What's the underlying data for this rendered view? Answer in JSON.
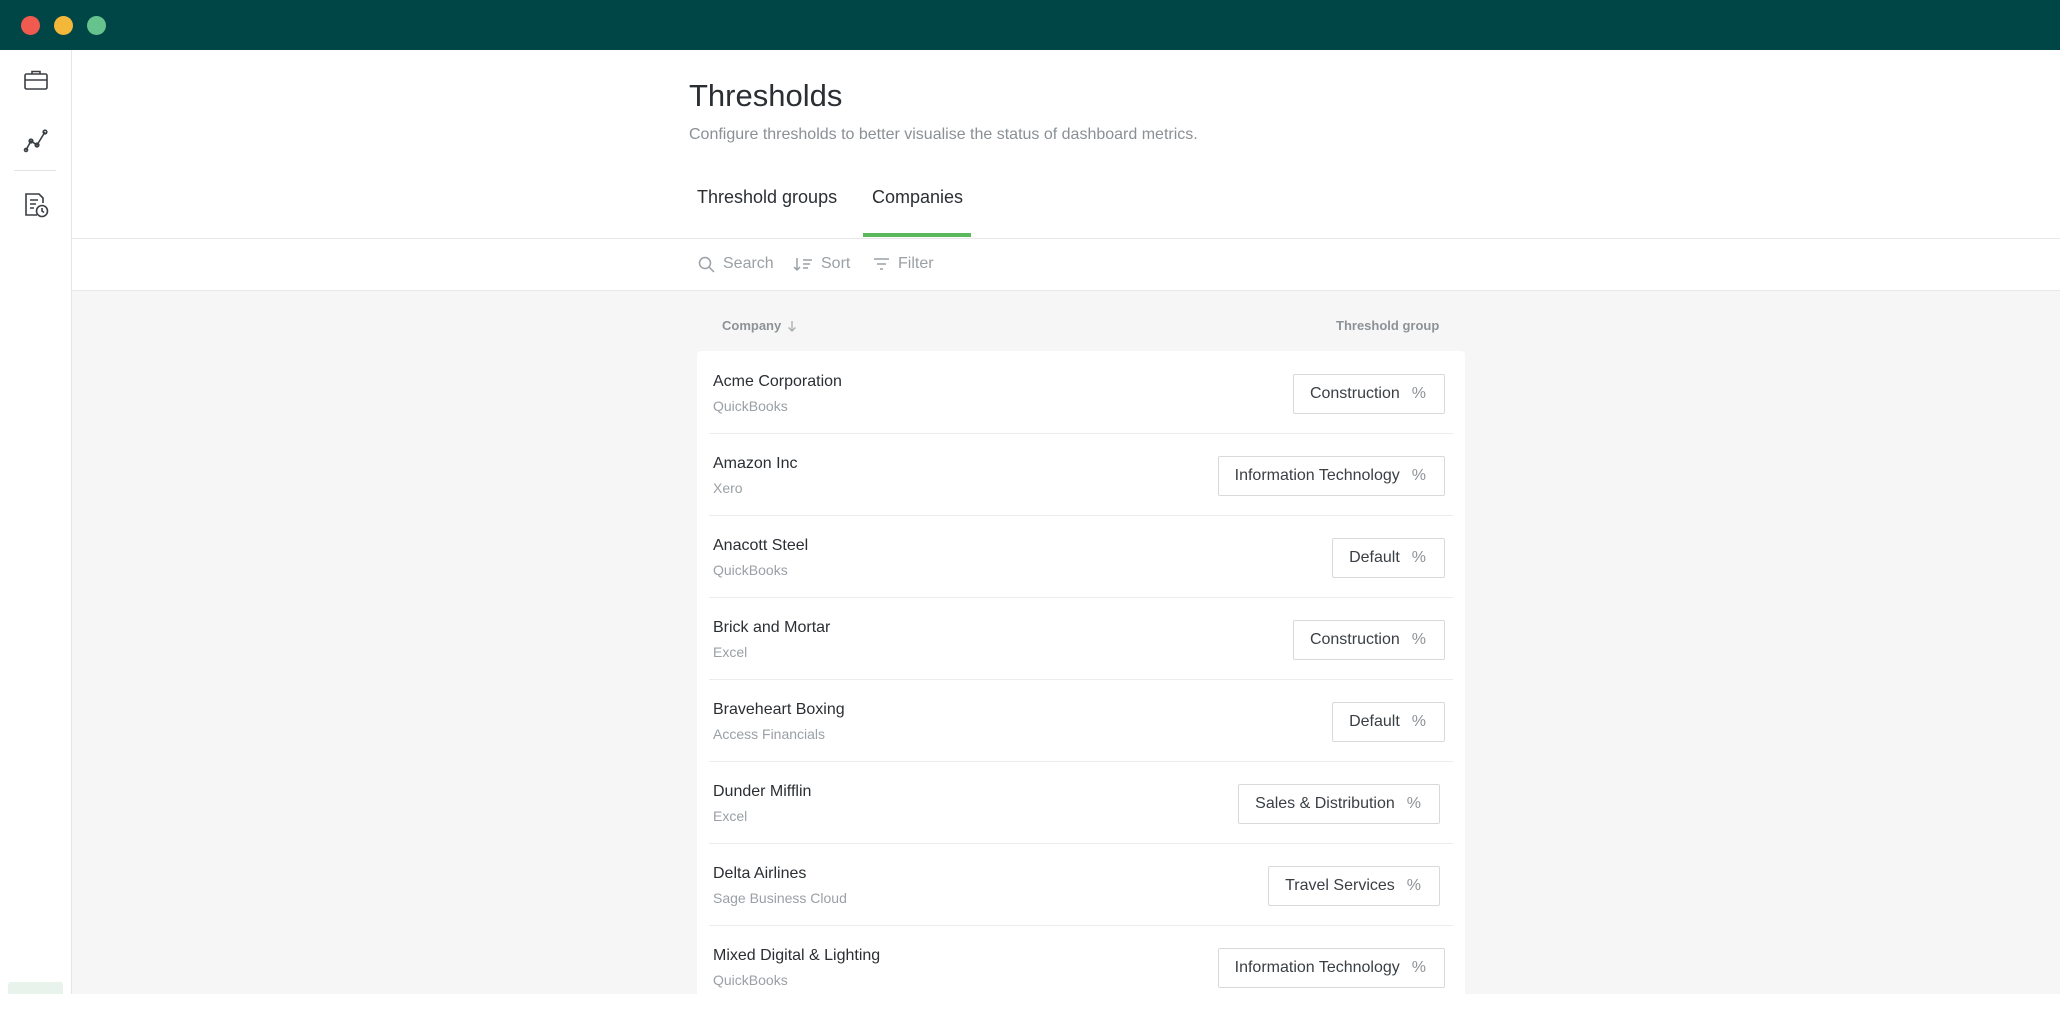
{
  "window": {
    "controls": [
      "close",
      "minimize",
      "maximize"
    ]
  },
  "sidebar": {
    "items": [
      {
        "name": "briefcase-icon"
      },
      {
        "name": "chart-line-icon"
      },
      {
        "name": "report-clock-icon"
      }
    ]
  },
  "page": {
    "title": "Thresholds",
    "subtitle": "Configure thresholds to better visualise the status of dashboard metrics."
  },
  "tabs": [
    {
      "label": "Threshold groups",
      "active": false
    },
    {
      "label": "Companies",
      "active": true
    }
  ],
  "colors": {
    "accent": "#5cb85c",
    "titlebar": "#004646"
  },
  "toolbar": {
    "search": "Search",
    "sort": "Sort",
    "filter": "Filter"
  },
  "table": {
    "columns": {
      "company": "Company",
      "group": "Threshold group"
    },
    "rows": [
      {
        "name": "Acme Corporation",
        "source": "QuickBooks",
        "group": "Construction"
      },
      {
        "name": "Amazon Inc",
        "source": "Xero",
        "group": "Information Technology"
      },
      {
        "name": "Anacott Steel",
        "source": "QuickBooks",
        "group": "Default"
      },
      {
        "name": "Brick and Mortar",
        "source": "Excel",
        "group": "Construction"
      },
      {
        "name": "Braveheart Boxing",
        "source": "Access Financials",
        "group": "Default"
      },
      {
        "name": "Dunder Mifflin",
        "source": "Excel",
        "group": "Sales & Distribution"
      },
      {
        "name": "Delta Airlines",
        "source": "Sage Business Cloud",
        "group": "Travel Services"
      },
      {
        "name": "Mixed Digital & Lighting",
        "source": "QuickBooks",
        "group": "Information Technology"
      }
    ],
    "pct_symbol": "%"
  }
}
